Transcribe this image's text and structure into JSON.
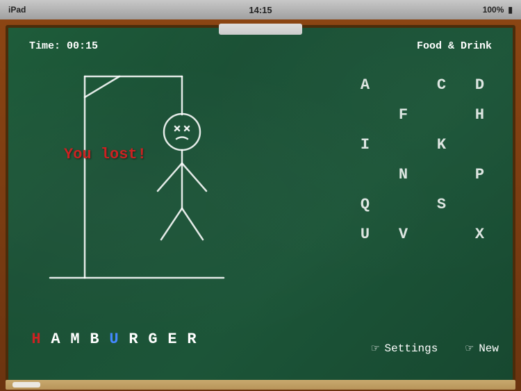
{
  "statusBar": {
    "left": "iPad",
    "time": "14:15",
    "right": "100%"
  },
  "game": {
    "timer_label": "Time: 00:15",
    "category": "Food & Drink",
    "you_lost": "You lost!",
    "word": [
      "H",
      "A",
      "M",
      "B",
      "U",
      "R",
      "G",
      "E",
      "R"
    ],
    "word_colors": [
      "red",
      "white",
      "white",
      "white",
      "blue",
      "white",
      "white",
      "white",
      "white"
    ],
    "letters_grid": [
      [
        "A",
        "",
        "C",
        "D"
      ],
      [
        "",
        "F",
        "",
        "H"
      ],
      [
        "I",
        "",
        "K",
        ""
      ],
      [
        "",
        "N",
        "",
        "P"
      ],
      [
        "Q",
        "",
        "S",
        ""
      ],
      [
        "U",
        "V",
        "",
        "X"
      ]
    ],
    "settings_label": "Settings",
    "new_label": "New"
  }
}
